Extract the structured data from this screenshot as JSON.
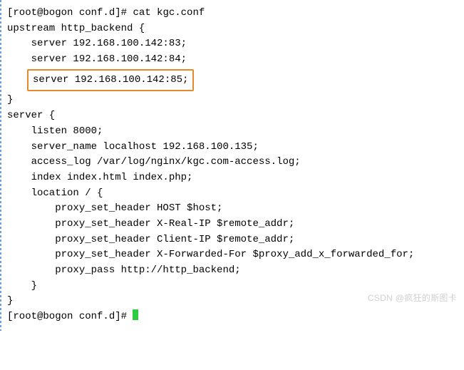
{
  "prompt1": "[root@bogon conf.d]# ",
  "cmd1": "cat kgc.conf",
  "upstream_open": "upstream http_backend {",
  "blank": "",
  "server1": "    server 192.168.100.142:83;",
  "server2": "    server 192.168.100.142:84;",
  "server3_highlight": "server 192.168.100.142:85;",
  "close_brace": "}",
  "server_block_open": "server {",
  "listen": "    listen 8000;",
  "server_name": "    server_name localhost 192.168.100.135;",
  "access_log": "    access_log /var/log/nginx/kgc.com-access.log;",
  "index": "    index index.html index.php;",
  "location_open": "    location / {",
  "pxy_host": "        proxy_set_header HOST $host;",
  "pxy_realip": "        proxy_set_header X-Real-IP $remote_addr;",
  "pxy_clientip": "        proxy_set_header Client-IP $remote_addr;",
  "pxy_xff": "        proxy_set_header X-Forwarded-For $proxy_add_x_forwarded_for;",
  "pxy_pass": "        proxy_pass http://http_backend;",
  "location_close": "    }",
  "server_block_close": "}",
  "prompt2": "[root@bogon conf.d]# ",
  "watermark": "CSDN @疯狂的斯图卡"
}
